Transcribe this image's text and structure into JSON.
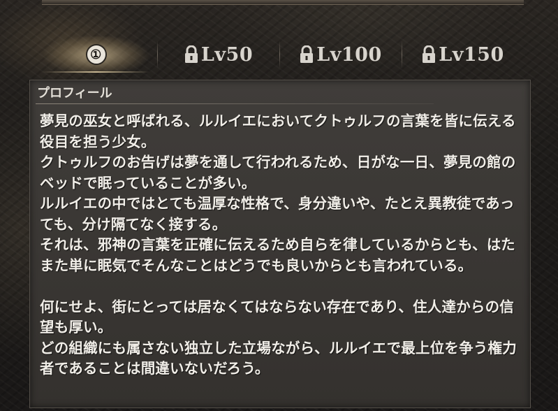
{
  "tabs": [
    {
      "label": "①",
      "locked": false,
      "active": true
    },
    {
      "label": "Lv50",
      "locked": true,
      "active": false
    },
    {
      "label": "Lv100",
      "locked": true,
      "active": false
    },
    {
      "label": "Lv150",
      "locked": true,
      "active": false
    }
  ],
  "icons": {
    "lock": "lock-icon"
  },
  "colors": {
    "active_tab_glow": "#d2be96",
    "text": "#f1eee8",
    "panel": "#3a3734"
  },
  "profile": {
    "heading": "プロフィール",
    "body": "夢見の巫女と呼ばれる、ルルイエにおいてクトゥルフの言葉を皆に伝える役目を担う少女。\nクトゥルフのお告げは夢を通して行われるため、日がな一日、夢見の館のベッドで眠っていることが多い。\nルルイエの中ではとても温厚な性格で、身分違いや、たとえ異教徒であっても、分け隔てなく接する。\nそれは、邪神の言葉を正確に伝えるため自らを律しているからとも、はたまた単に眠気でそんなことはどうでも良いからとも言われている。\n\n何にせよ、街にとっては居なくてはならない存在であり、住人達からの信望も厚い。\nどの組織にも属さない独立した立場ながら、ルルイエで最上位を争う権力者であることは間違いないだろう。"
  }
}
